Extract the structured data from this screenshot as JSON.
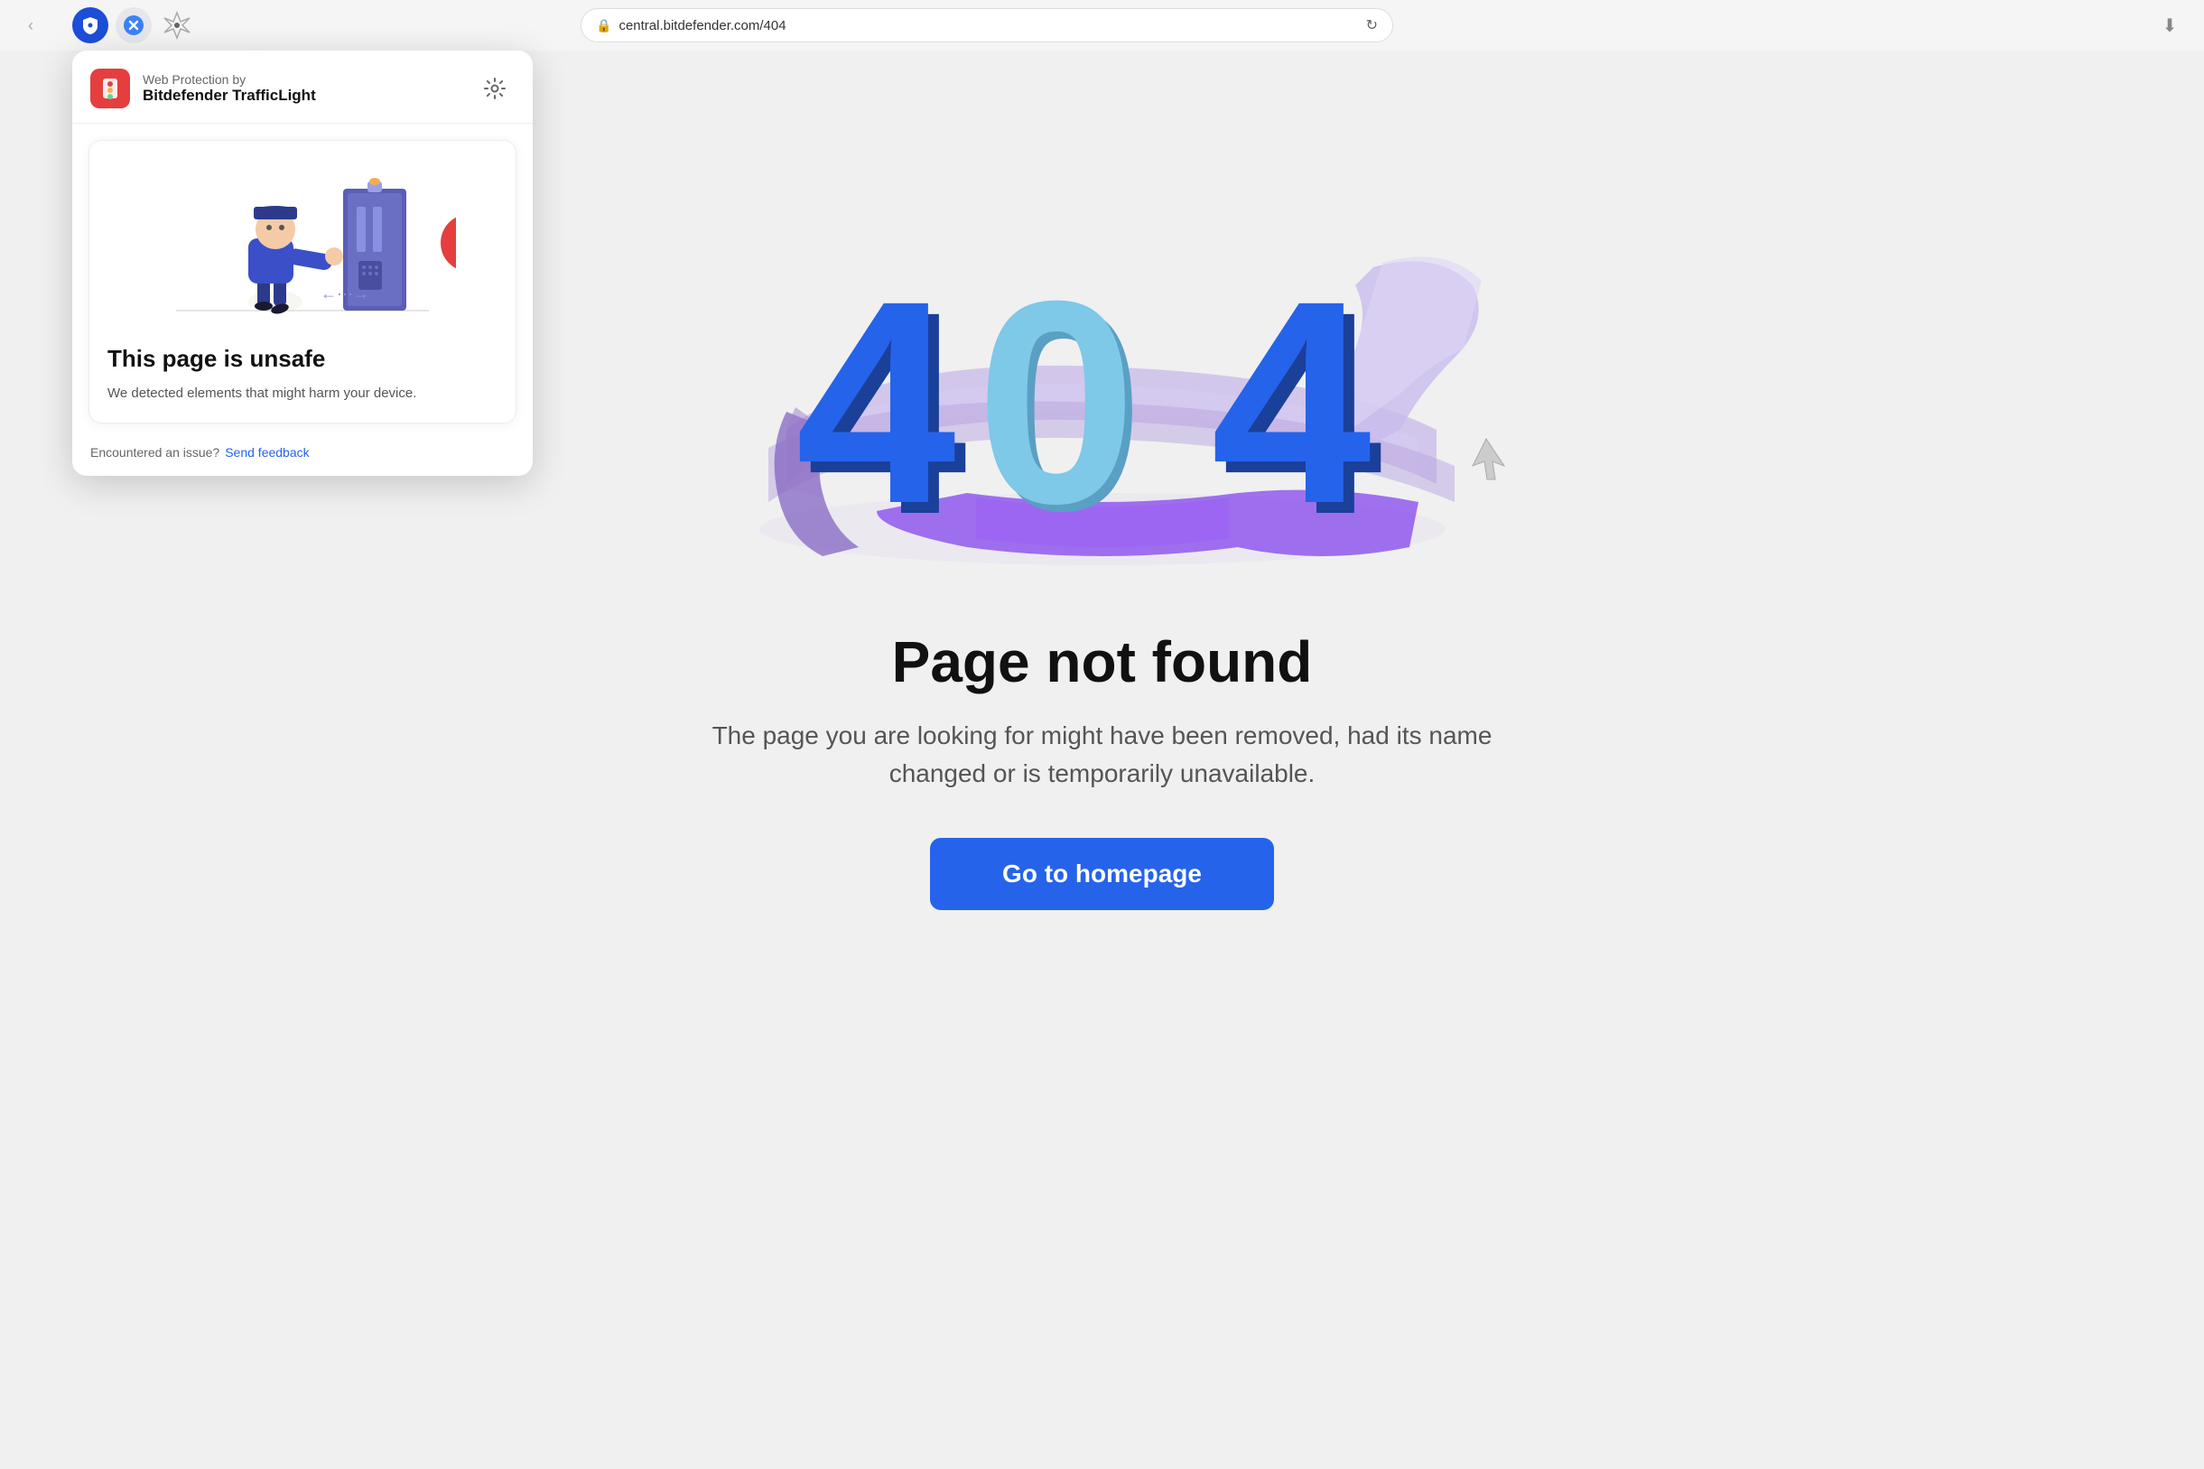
{
  "browser": {
    "url": "central.bitdefender.com/404",
    "nav_back": "‹",
    "reload_icon": "↻",
    "download_icon": "⬇"
  },
  "extensions": [
    {
      "id": "bitwarden",
      "label": "Bitwarden"
    },
    {
      "id": "close",
      "label": "Close"
    },
    {
      "id": "craft",
      "label": "Craft"
    }
  ],
  "trafficlight_popup": {
    "by_text": "Web Protection by",
    "brand": "Bitdefender TrafficLight",
    "logo_letter": "🛑",
    "card": {
      "title": "This page is unsafe",
      "description": "We detected elements that might harm your device."
    },
    "footer": {
      "encountered_text": "Encountered an issue?",
      "feedback_label": "Send feedback"
    }
  },
  "page_404": {
    "title": "Page not found",
    "description": "The page you are looking for might have been removed, had its name changed or is temporarily unavailable.",
    "button_label": "Go to homepage"
  }
}
